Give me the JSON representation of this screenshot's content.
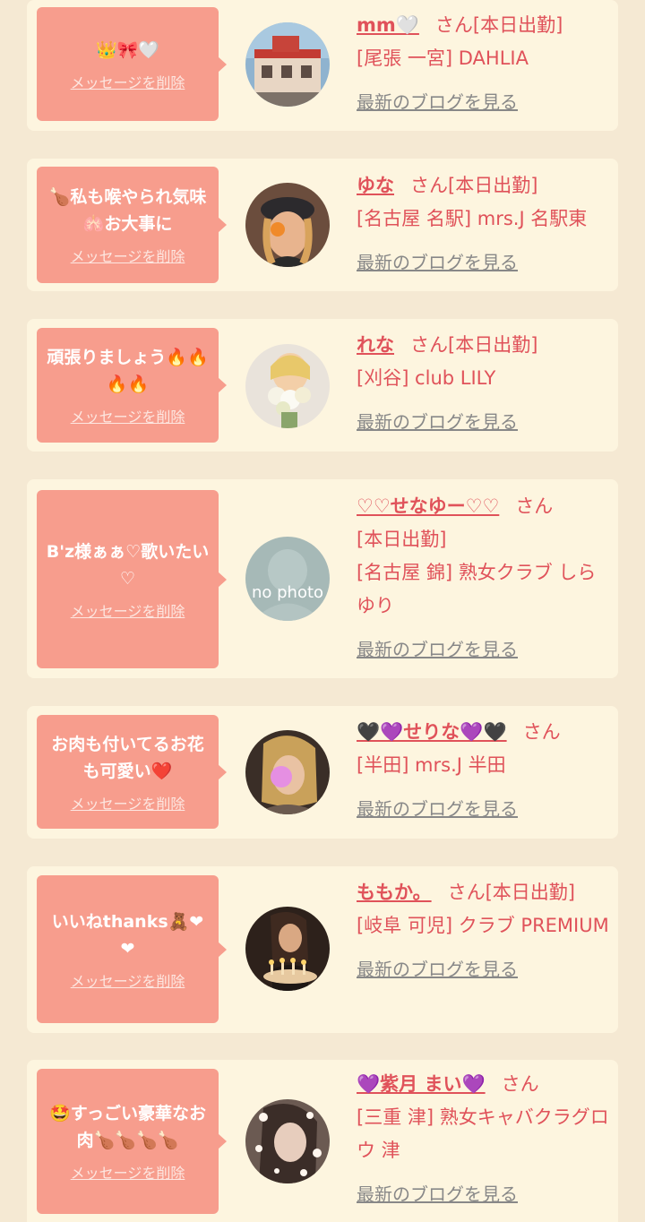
{
  "delete_label": "メッセージを削除",
  "blog_label": "最新のブログを見る",
  "entries": [
    {
      "message": "👑🎀🤍",
      "name": "mm🤍",
      "san": "さん[本日出勤]",
      "area": "[尾張 一宮] DAHLIA",
      "avatar_icon": "building-photo-avatar"
    },
    {
      "message": "🍗私も喉やられ気味🫁お大事に",
      "name": "ゆな",
      "san": "さん[本日出勤]",
      "area": "[名古屋 名駅] mrs.J 名駅東",
      "avatar_icon": "police-hat-photo-avatar"
    },
    {
      "message": "頑張りましょう🔥🔥🔥🔥",
      "name": "れな",
      "san": "さん[本日出勤]",
      "area": "[刈谷] club LILY",
      "avatar_icon": "bouquet-photo-avatar"
    },
    {
      "message": "B'z様ぁぁ♡歌いたい♡",
      "name": "♡♡せなゆー♡♡",
      "san": "さん",
      "status": "[本日出勤]",
      "area": "[名古屋 錦] 熟女クラブ しらゆり",
      "avatar_text": "no photo",
      "avatar_icon": "no-photo-avatar"
    },
    {
      "message": "お肉も付いてるお花も可愛い❤️",
      "name": "🖤💜せりな💜🖤",
      "san": "さん",
      "area": "[半田] mrs.J 半田",
      "avatar_icon": "blonde-photo-avatar"
    },
    {
      "message": "いいねthanks🧸❤❤",
      "name": "ももか。",
      "san": "さん[本日出勤]",
      "area": "[岐阜 可児] クラブ PREMIUM",
      "avatar_icon": "candles-photo-avatar"
    },
    {
      "message": "🤩すっごい豪華なお肉🍗🍗🍗🍗",
      "name": "💜紫月 まい💜",
      "san": "さん",
      "area": "[三重 津] 熟女キャバクラグロウ 津",
      "avatar_icon": "sparkle-photo-avatar"
    }
  ],
  "colors": {
    "background": "#f5e9d3",
    "card": "#fdf5df",
    "bubble": "#f79d8d",
    "name": "#e0525a",
    "link_gray": "#888888"
  }
}
